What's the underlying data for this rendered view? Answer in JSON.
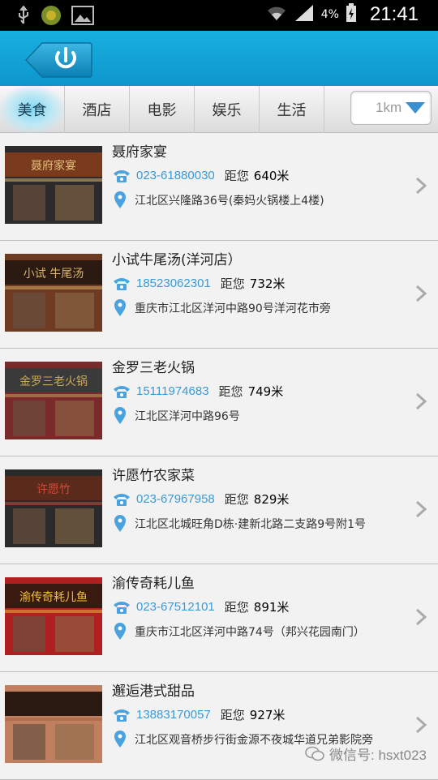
{
  "status_bar": {
    "battery": "4%",
    "time": "21:41"
  },
  "header": {
    "back_icon": "power-icon"
  },
  "tabs": [
    {
      "label": "美食",
      "active": true
    },
    {
      "label": "酒店",
      "active": false
    },
    {
      "label": "电影",
      "active": false
    },
    {
      "label": "娱乐",
      "active": false
    },
    {
      "label": "生活",
      "active": false
    }
  ],
  "distance_filter": {
    "value": "1km"
  },
  "distance_prefix": "距您",
  "listings": [
    {
      "name": "聂府家宴",
      "phone": "023-61880030",
      "distance": "640米",
      "address": "江北区兴隆路36号(秦妈火锅楼上4楼)"
    },
    {
      "name": "小试牛尾汤(洋河店）",
      "phone": "18523062301",
      "distance": "732米",
      "address": "重庆市江北区洋河中路90号洋河花市旁"
    },
    {
      "name": "金罗三老火锅",
      "phone": "15111974683",
      "distance": "749米",
      "address": "江北区洋河中路96号"
    },
    {
      "name": "许愿竹农家菜",
      "phone": "023-67967958",
      "distance": "829米",
      "address": "江北区北城旺角D栋·建新北路二支路9号附1号"
    },
    {
      "name": "渝传奇耗儿鱼",
      "phone": "023-67512101",
      "distance": "891米",
      "address": "重庆市江北区洋河中路74号（邦兴花园南门）"
    },
    {
      "name": "邂逅港式甜品",
      "phone": "13883170057",
      "distance": "927米",
      "address": "江北区观音桥步行街金源不夜城华道兄弟影院旁"
    }
  ],
  "thumb_signs": [
    "聂府家宴",
    "小试 牛尾汤",
    "金罗三老火锅",
    "许愿竹",
    "渝传奇耗儿鱼",
    ""
  ],
  "watermark": "微信号: hsxt023",
  "colors": {
    "accent": "#0e96cc",
    "phone": "#3a9ad6",
    "pin": "#4aa3de"
  }
}
